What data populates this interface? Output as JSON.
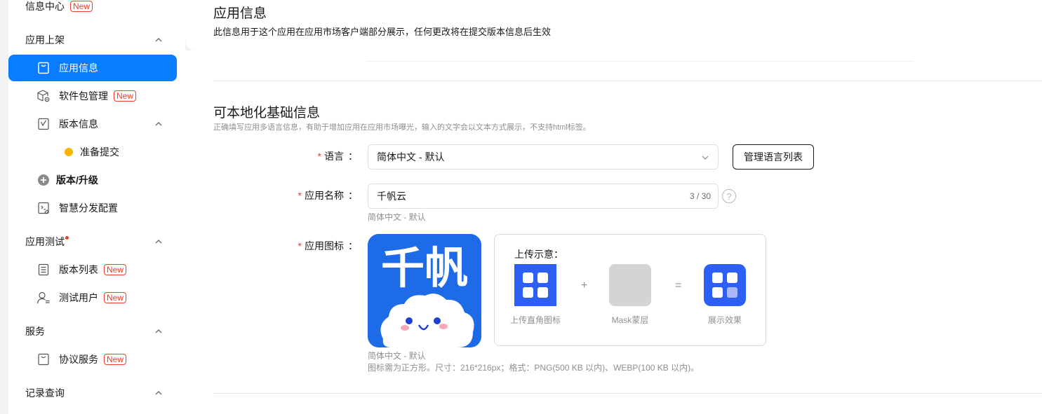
{
  "sidebar": {
    "info_center": {
      "label": "信息中心",
      "badge": "New"
    },
    "group_listing": {
      "label": "应用上架"
    },
    "items": {
      "app_info": {
        "label": "应用信息"
      },
      "package_mgmt": {
        "label": "软件包管理",
        "badge": "New"
      },
      "version_info": {
        "label": "版本信息"
      },
      "prepare_submit": {
        "label": "准备提交"
      },
      "version_upgrade": {
        "label": "版本/升级"
      },
      "smart_distribution": {
        "label": "智慧分发配置"
      },
      "version_list": {
        "label": "版本列表",
        "badge": "New"
      },
      "test_users": {
        "label": "测试用户",
        "badge": "New"
      },
      "agreement_service": {
        "label": "协议服务",
        "badge": "New"
      }
    },
    "group_testing": {
      "label": "应用测试"
    },
    "group_service": {
      "label": "服务"
    },
    "group_records": {
      "label": "记录查询"
    }
  },
  "header": {
    "title": "应用信息",
    "description": "此信息用于这个应用在应用市场客户端部分展示，任何更改将在提交版本信息后生效"
  },
  "section": {
    "title": "可本地化基础信息",
    "description": "正确填写应用多语言信息，有助于增加应用在应用市场曝光，输入的文字会以文本方式展示，不支持html标签。"
  },
  "form": {
    "required_mark": "*",
    "colon": "：",
    "language": {
      "label": "语言",
      "value": "简体中文 - 默认",
      "manage_button": "管理语言列表"
    },
    "app_name": {
      "label": "应用名称",
      "value": "千帆云",
      "counter": "3 / 30",
      "help": "?",
      "hint": "简体中文 - 默认"
    },
    "app_icon": {
      "label": "应用图标",
      "icon_text": "千帆",
      "hint_lang": "简体中文 - 默认",
      "hint_spec": "图标需为正方形。尺寸：216*216px；格式：PNG(500 KB 以内)、WEBP(100 KB 以内)。"
    }
  },
  "upload_demo": {
    "title": "上传示意：",
    "plus": "+",
    "equals": "=",
    "captions": [
      "上传直角图标",
      "Mask蒙层",
      "展示效果"
    ]
  },
  "colors": {
    "accent": "#0a7cff",
    "required": "#e84026",
    "icon_blue": "#1e6be8",
    "demo_blue": "#2d5ff5",
    "pending": "#f7b500"
  }
}
